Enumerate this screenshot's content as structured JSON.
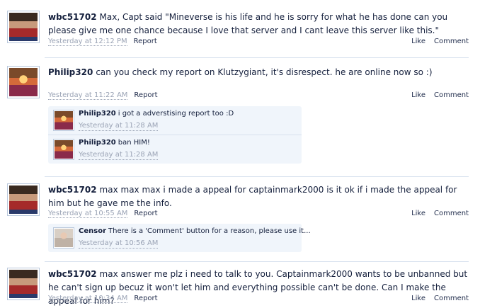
{
  "actions": {
    "like": "Like",
    "comment": "Comment",
    "report": "Report"
  },
  "posts": [
    {
      "user": "wbc51702",
      "avatar_icon": "minecraft-skin-avatar",
      "text": "Max, Capt said \"Mineverse is his life and he is sorry for what he has done can you please give me one chance because I love that server and I cant leave this server like this.\"",
      "time": "Yesterday at 12:12 PM"
    },
    {
      "user": "Philip320",
      "avatar_icon": "minecraft-skin-avatar",
      "text": "can you check my report on Klutzygiant, it's disrespect. he are online now so :)",
      "time": "Yesterday at 11:22 AM",
      "comments": [
        {
          "user": "Philip320",
          "text": "i got a adverstising report too :D",
          "time": "Yesterday at 11:28 AM"
        },
        {
          "user": "Philip320",
          "text": "ban HIM!",
          "time": "Yesterday at 11:28 AM"
        }
      ]
    },
    {
      "user": "wbc51702",
      "avatar_icon": "minecraft-skin-avatar",
      "text": "max max max i made a appeal for captainmark2000 is it ok if i made the appeal for him but he gave me the info.",
      "time": "Yesterday at 10:55 AM",
      "comments": [
        {
          "user": "Censor",
          "text": "There is a 'Comment' button for a reason, please use it...",
          "time": "Yesterday at 10:56 AM"
        }
      ]
    },
    {
      "user": "wbc51702",
      "avatar_icon": "minecraft-skin-avatar",
      "text": "max answer me plz i need to talk to you. Captainmark2000 wants to be unbanned but he can't sign up becuz it won't let him and everything possible can't be done. Can I make the appeal for him?",
      "time": "Yesterday at 10:34 AM"
    }
  ]
}
